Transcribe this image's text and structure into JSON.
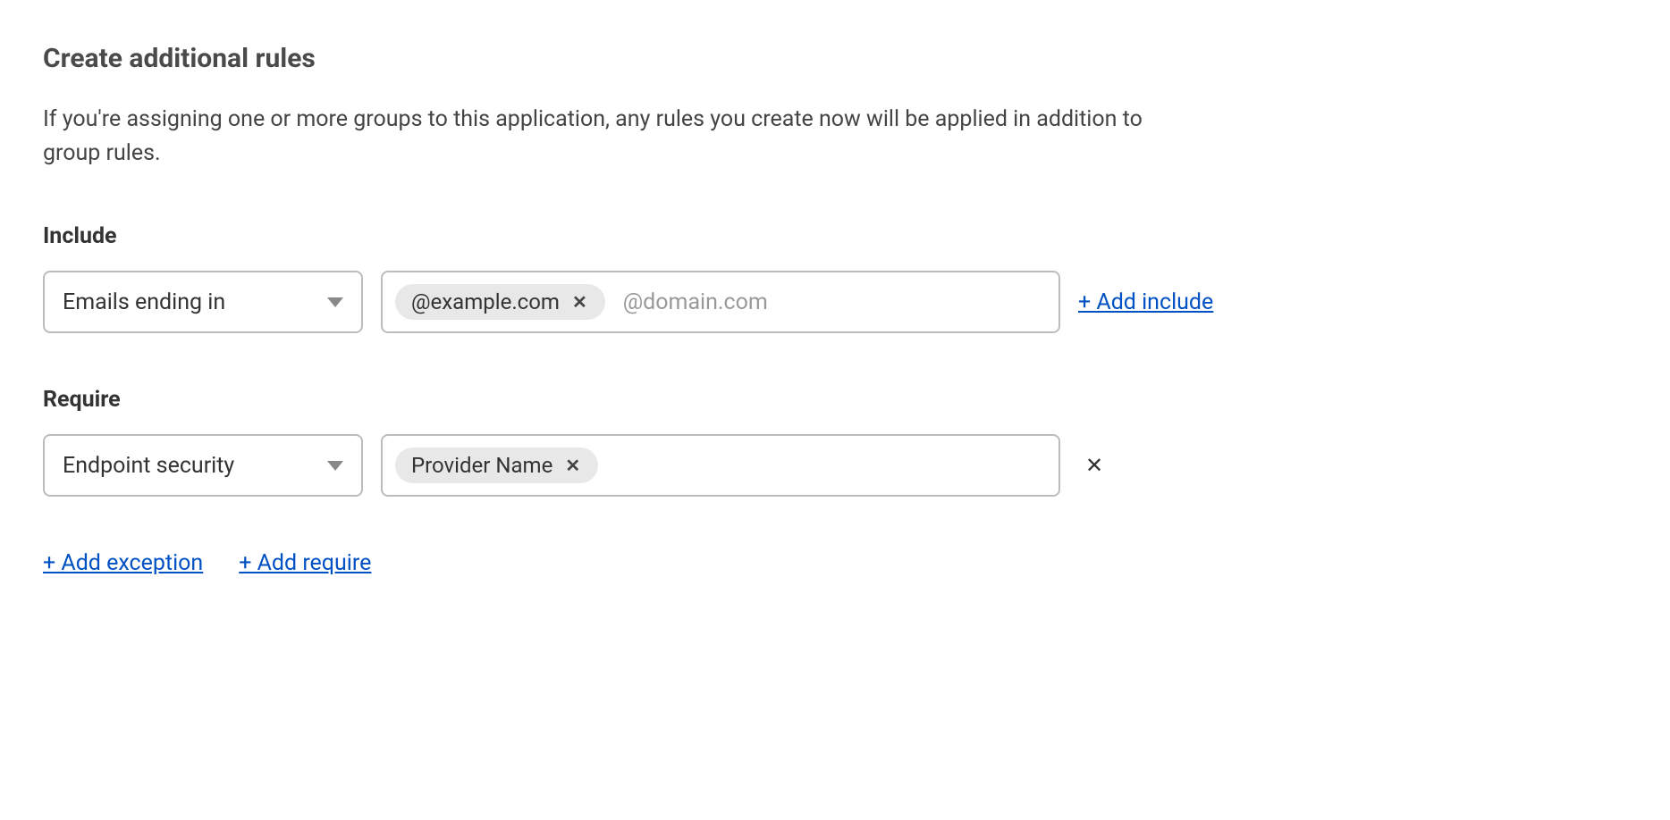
{
  "heading": "Create additional rules",
  "description": "If you're assigning one or more groups to this application, any rules you create now will be applied in addition to group rules.",
  "include": {
    "label": "Include",
    "select_value": "Emails ending in",
    "tag_value": "@example.com",
    "placeholder": "@domain.com",
    "add_link": "+ Add include"
  },
  "require": {
    "label": "Require",
    "select_value": "Endpoint security",
    "tag_value": "Provider Name"
  },
  "bottom_links": {
    "add_exception": "+ Add exception",
    "add_require": "+ Add require"
  }
}
